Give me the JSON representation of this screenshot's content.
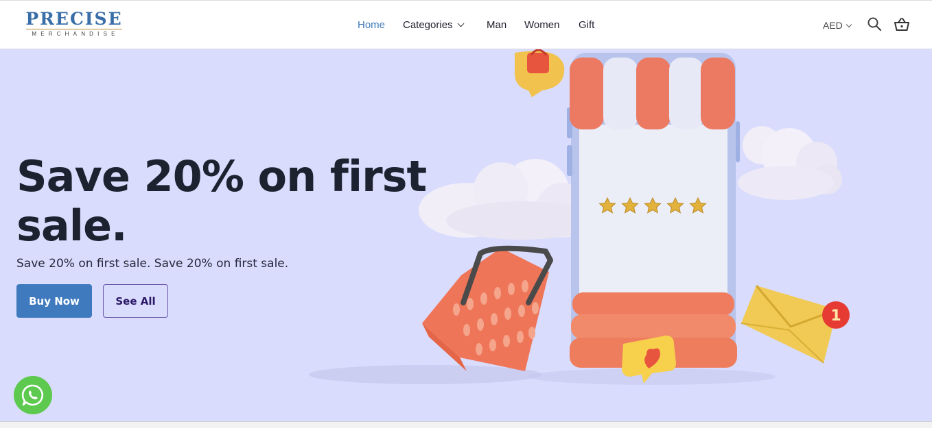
{
  "brand": {
    "name": "PRECISE",
    "tagline": "MERCHANDISE",
    "color": "#3a6ea8"
  },
  "nav": {
    "items": [
      {
        "label": "Home",
        "active": true
      },
      {
        "label": "Categories",
        "has_dropdown": true
      },
      {
        "label": "Man"
      },
      {
        "label": "Women"
      },
      {
        "label": "Gift"
      }
    ]
  },
  "header_actions": {
    "currency": "AED",
    "icons": [
      "search-icon",
      "basket-icon"
    ]
  },
  "hero": {
    "title": "Save 20% on first sale.",
    "subtitle": "Save 20% on first sale. Save 20% on first sale.",
    "primary_button": "Buy Now",
    "secondary_button": "See All",
    "background": "#d9dcfc",
    "illustration": {
      "rating_stars": 5,
      "notification_count": "1",
      "icons": [
        "shop-awning-icon",
        "shopping-basket-icon",
        "envelope-icon",
        "heart-chat-icon",
        "cloud-icon"
      ]
    }
  },
  "floating": {
    "icon": "whatsapp-icon",
    "color": "#5dc94e"
  },
  "colors": {
    "accent": "#3f79be",
    "text": "#1d2230",
    "outline": "#6a55a8"
  }
}
